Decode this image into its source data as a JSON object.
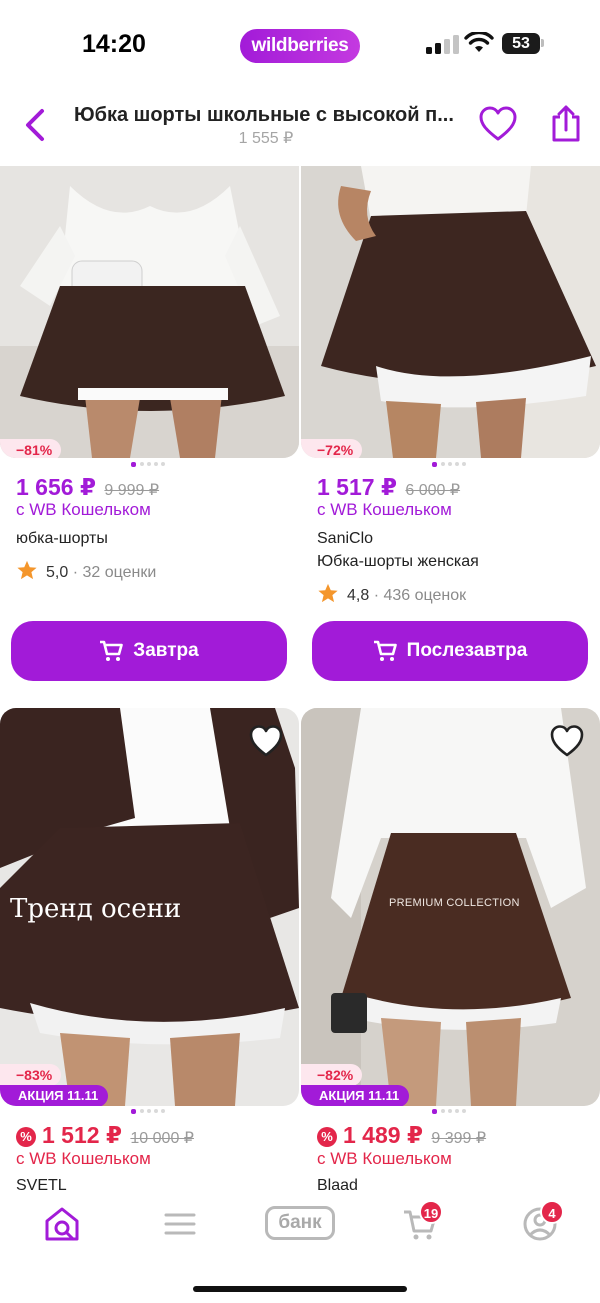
{
  "status_bar": {
    "time": "14:20",
    "brand": "wildberries",
    "battery": "53"
  },
  "header": {
    "title": "Юбка шорты школьные с высокой п...",
    "subtitle": "1 555 ₽",
    "back_icon": "chevron-left-icon",
    "favorite_icon": "heart-icon",
    "share_icon": "share-icon"
  },
  "products": [
    {
      "discount": "−81%",
      "price": "1 656 ₽",
      "old_price": "9 999 ₽",
      "wallet": "с WB Кошельком",
      "name": "юбка-шорты",
      "rating": "5,0",
      "reviews": "· 32 оценки",
      "delivery_label": "Завтра"
    },
    {
      "discount": "−72%",
      "price": "1 517 ₽",
      "old_price": "6 000 ₽",
      "wallet": "с WB Кошельком",
      "brand": "SaniClo",
      "name": "Юбка-шорты женская",
      "rating": "4,8",
      "reviews": "· 436 оценок",
      "delivery_label": "Послезавтра"
    },
    {
      "overlay_text": "Тренд осени",
      "discount": "−83%",
      "promo": "АКЦИЯ 11.11",
      "price": "1 512 ₽",
      "old_price": "10 000 ₽",
      "wallet": "с WB Кошельком",
      "brand": "SVETL"
    },
    {
      "overlay_text": "PREMIUM COLLECTION",
      "discount": "−82%",
      "promo": "АКЦИЯ 11.11",
      "price": "1 489 ₽",
      "old_price": "9 399 ₽",
      "wallet": "с WB Кошельком",
      "brand": "Blaad"
    }
  ],
  "bottom_nav": {
    "bank_label": "банк",
    "cart_badge": "19",
    "profile_badge": "4",
    "icons": [
      "home-search-icon",
      "menu-icon",
      "bank-icon",
      "cart-icon",
      "profile-icon"
    ]
  },
  "colors": {
    "accent": "#a21bd8",
    "sale": "#e3264a",
    "muted": "#9a9a9a"
  }
}
